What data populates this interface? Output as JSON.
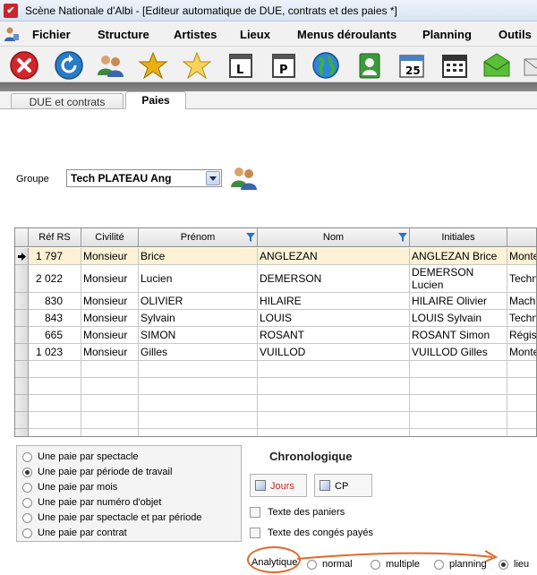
{
  "window": {
    "title": "Scène Nationale d'Albi - [Editeur automatique de DUE, contrats et des paies *]"
  },
  "menu": [
    "Fichier",
    "Structure",
    "Artistes",
    "Lieux",
    "Menus déroulants",
    "Planning",
    "Outils"
  ],
  "toolbar": {
    "icons": [
      "close-icon",
      "refresh-icon",
      "users-icon",
      "star-gold-icon",
      "star-icon",
      "letter-l-icon",
      "letter-p-icon",
      "globe-icon",
      "contact-card-icon",
      "calendar-date-icon",
      "calendar-icon",
      "envelope-icon",
      "envelope-arrow-icon"
    ],
    "calendar_day": "25"
  },
  "tabs": [
    {
      "label": "DUE et contrats",
      "active": false
    },
    {
      "label": "Paies",
      "active": true
    }
  ],
  "group": {
    "label": "Groupe",
    "value": "Tech PLATEAU Ang"
  },
  "grid": {
    "columns": [
      "Réf RS",
      "Civilité",
      "Prénom",
      "Nom",
      "Initiales",
      ""
    ],
    "rows": [
      {
        "ref": "1 797",
        "civilite": "Monsieur",
        "prenom": "Brice",
        "nom": "ANGLEZAN",
        "initiales": "ANGLEZAN Brice",
        "extra": "Monte",
        "selected": true
      },
      {
        "ref": "2 022",
        "civilite": "Monsieur",
        "prenom": "Lucien",
        "nom": "DEMERSON",
        "initiales": "DEMERSON Lucien",
        "extra": "Techn",
        "selected": false
      },
      {
        "ref": "830",
        "civilite": "Monsieur",
        "prenom": "OLIVIER",
        "nom": "HILAIRE",
        "initiales": "HILAIRE Olivier",
        "extra": "Machi",
        "selected": false
      },
      {
        "ref": "843",
        "civilite": "Monsieur",
        "prenom": "Sylvain",
        "nom": "LOUIS",
        "initiales": "LOUIS Sylvain",
        "extra": "Techn",
        "selected": false
      },
      {
        "ref": "665",
        "civilite": "Monsieur",
        "prenom": "SIMON",
        "nom": "ROSANT",
        "initiales": "ROSANT Simon",
        "extra": "Régis",
        "selected": false
      },
      {
        "ref": "1 023",
        "civilite": "Monsieur",
        "prenom": "Gilles",
        "nom": "VUILLOD",
        "initiales": "VUILLOD Gilles",
        "extra": "Monte",
        "selected": false
      }
    ]
  },
  "pay_options": {
    "items": [
      "Une paie par spectacle",
      "Une paie par période de travail",
      "Une paie par mois",
      "Une paie par numéro d'objet",
      "Une paie par spectacle et par période",
      "Une paie par contrat"
    ],
    "selected_index": 1
  },
  "chrono": {
    "title": "Chronologique",
    "jours_label": "Jours",
    "cp_label": "CP",
    "jours_color": "#cc2222"
  },
  "checkboxes": [
    "Texte des paniers",
    "Texte des congés payés"
  ],
  "analytique": {
    "label": "Analytique",
    "options": [
      "normal",
      "multiple",
      "planning",
      "lieu"
    ],
    "selected_index": 3,
    "highlight_color": "#e06a2c"
  }
}
